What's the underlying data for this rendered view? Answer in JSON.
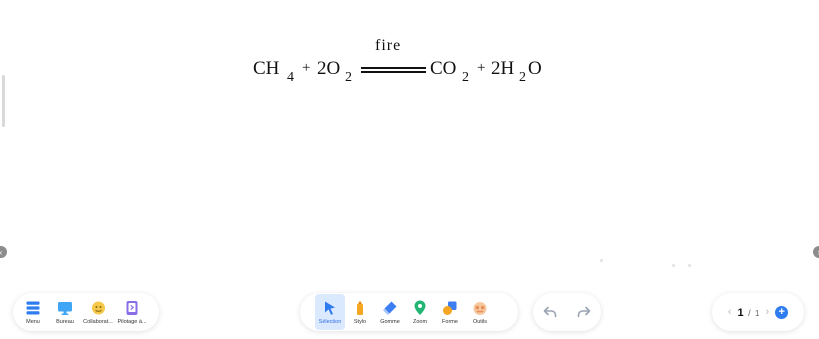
{
  "equation": {
    "reactant_1": "CH",
    "reactant_1_sub": "4",
    "plus_1": "+",
    "reactant_2": "2O",
    "reactant_2_sub": "2",
    "condition": "fire",
    "product_1": "CO",
    "product_1_sub": "2",
    "plus_2": "+",
    "product_2_a": "2H",
    "product_2_sub": "2",
    "product_2_b": "O"
  },
  "left_toolbar": {
    "items": [
      {
        "label": "Menu",
        "icon": "menu-icon"
      },
      {
        "label": "Bureau",
        "icon": "desktop-icon"
      },
      {
        "label": "Collaborat...",
        "icon": "collaboration-icon"
      },
      {
        "label": "Pilotage à...",
        "icon": "remote-control-icon"
      }
    ]
  },
  "center_toolbar": {
    "items": [
      {
        "label": "Sélection",
        "icon": "cursor-icon",
        "active": true
      },
      {
        "label": "Stylo",
        "icon": "pen-icon"
      },
      {
        "label": "Gomme",
        "icon": "eraser-icon"
      },
      {
        "label": "Zoom",
        "icon": "location-pin-icon"
      },
      {
        "label": "Forme",
        "icon": "shapes-icon"
      },
      {
        "label": "Outils",
        "icon": "tools-icon"
      }
    ]
  },
  "pager": {
    "current": "1",
    "separator": "/",
    "total": "1",
    "add": "+"
  },
  "colors": {
    "accent": "#2f7bf0",
    "active_bg": "#dbe9ff"
  }
}
